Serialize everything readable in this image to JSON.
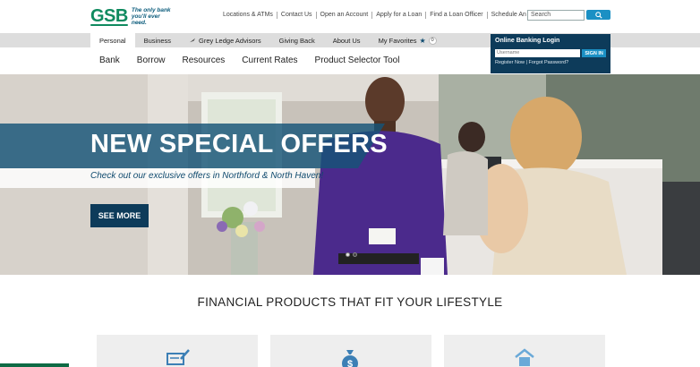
{
  "header": {
    "logo_text": "GSB",
    "tagline": "The only bank you'll ever need.",
    "utility_links": [
      "Locations & ATMs",
      "Contact Us",
      "Open an Account",
      "Apply for a Loan",
      "Find a Loan Officer",
      "Schedule An Appointment"
    ],
    "search_placeholder": "Search"
  },
  "primary_nav": {
    "items": [
      "Personal",
      "Business",
      "Grey Ledge Advisors",
      "Giving Back",
      "About Us"
    ],
    "active": "Personal",
    "favorites_label": "My Favorites",
    "favorites_count": "0"
  },
  "secondary_nav": {
    "items": [
      "Bank",
      "Borrow",
      "Resources",
      "Current Rates",
      "Product Selector Tool"
    ]
  },
  "login": {
    "title": "Online Banking Login",
    "username_placeholder": "Username",
    "sign_in_label": "SIGN IN",
    "register_link": "Register Now",
    "forgot_link": "Forgot Password?"
  },
  "hero": {
    "title": "NEW SPECIAL OFFERS",
    "subtitle": "Check out our exclusive offers in Northford & North Haven!",
    "cta_label": "SEE MORE",
    "slide_count": 2,
    "active_slide": 2
  },
  "products": {
    "title": "FINANCIAL PRODUCTS THAT FIT YOUR LIFESTYLE",
    "card_icons": [
      "check-writing-icon",
      "money-bag-icon",
      "house-icon"
    ]
  },
  "colors": {
    "brand_green": "#0f8a5f",
    "navy": "#0d3b5a",
    "accent_blue": "#1b90c4"
  }
}
